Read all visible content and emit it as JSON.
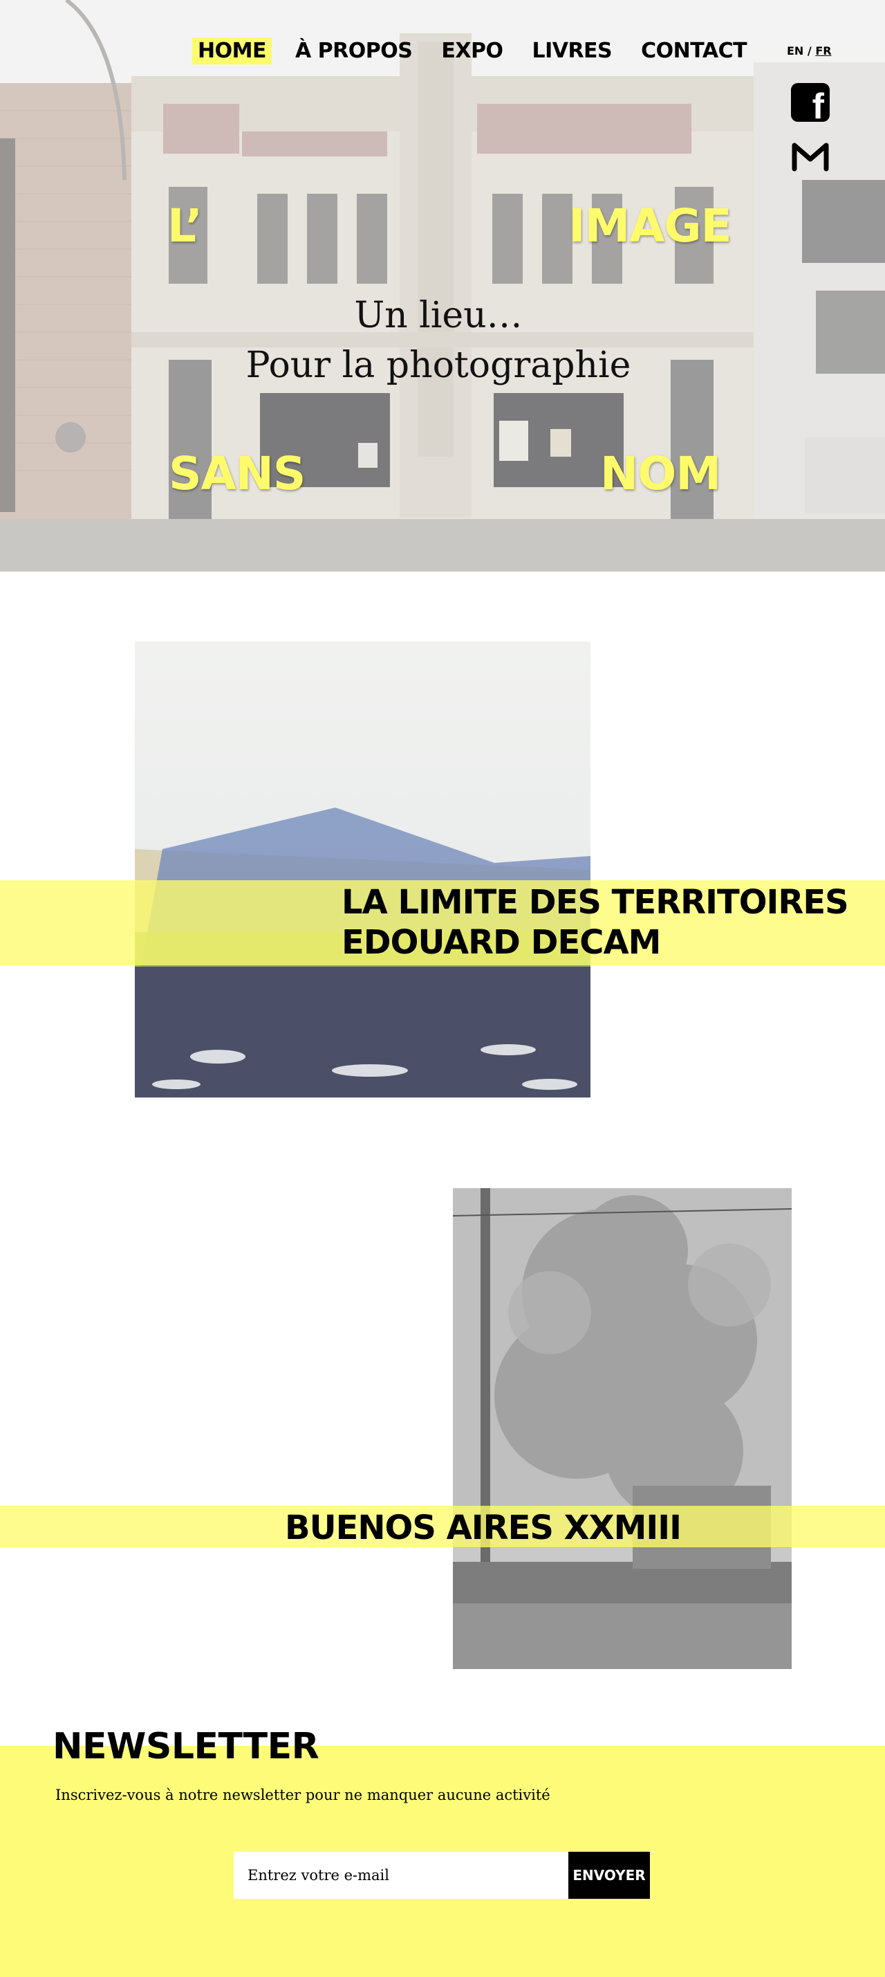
{
  "nav": {
    "items": [
      {
        "label": "HOME",
        "active": true
      },
      {
        "label": "À PROPOS",
        "active": false
      },
      {
        "label": "EXPO",
        "active": false
      },
      {
        "label": "LIVRES",
        "active": false
      },
      {
        "label": "CONTACT",
        "active": false
      }
    ]
  },
  "lang": {
    "en": "EN",
    "sep": " / ",
    "fr": "FR",
    "current": "FR"
  },
  "social": {
    "facebook_icon": "facebook-icon",
    "mail_icon": "gmail-icon"
  },
  "hero": {
    "word_l": "L’",
    "word_image": "IMAGE",
    "word_sans": "SANS",
    "word_nom": "NOM",
    "tagline_1": "Un lieu…",
    "tagline_2": "Pour la photographie"
  },
  "expos": [
    {
      "title_line1": "LA LIMITE DES TERRITOIRES",
      "title_line2": "EDOUARD DECAM"
    },
    {
      "title_line1": "BUENOS AIRES XXMIII"
    }
  ],
  "newsletter": {
    "title": "NEWSLETTER",
    "text": "Inscrivez-vous à notre newsletter pour ne manquer aucune activité",
    "placeholder": "Entrez votre e-mail",
    "button": "ENVOYER"
  },
  "colors": {
    "accent_yellow": "#fdfb6b",
    "black": "#000000",
    "white": "#ffffff"
  }
}
